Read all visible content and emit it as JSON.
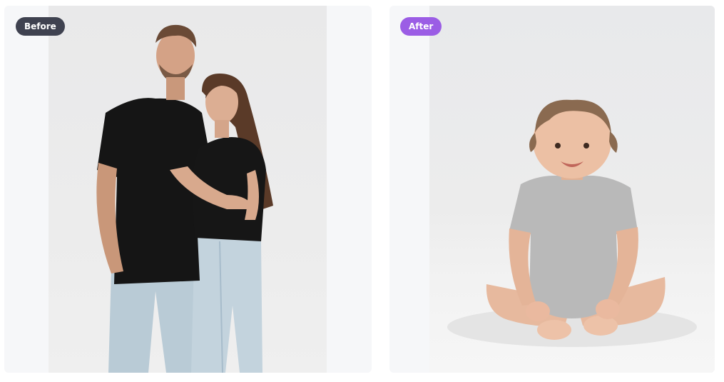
{
  "comparison": {
    "before": {
      "label": "Before",
      "badge_color": "#3f4250",
      "image": "couple-in-black-tshirts-and-jeans-photo"
    },
    "after": {
      "label": "After",
      "badge_color": "#9b5de5",
      "image": "baby-in-grey-bodysuit-sitting-photo"
    }
  }
}
